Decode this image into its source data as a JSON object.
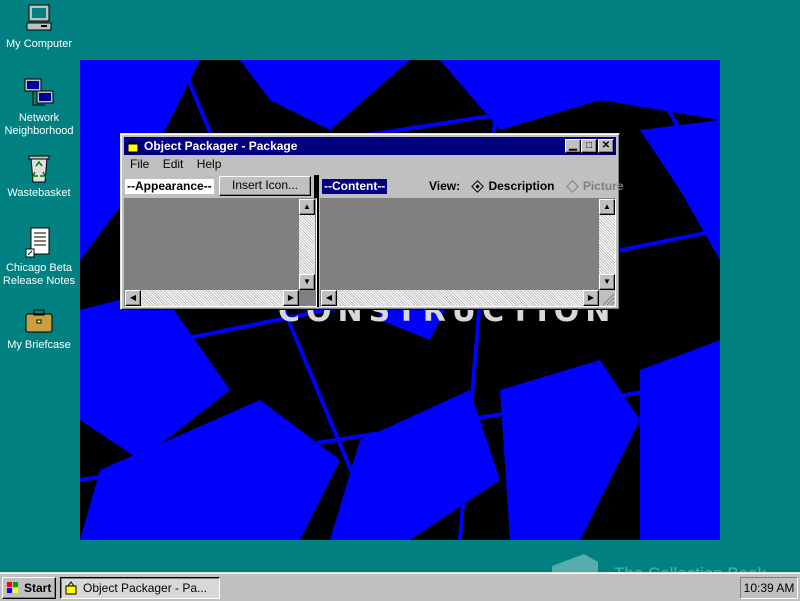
{
  "desktop": {
    "icons": [
      {
        "label": "My Computer",
        "icon": "computer-icon"
      },
      {
        "label": "Network Neighborhood",
        "icon": "network-icon"
      },
      {
        "label": "Wastebasket",
        "icon": "recycle-bin-icon"
      },
      {
        "label": "Chicago Beta Release Notes",
        "icon": "document-icon"
      },
      {
        "label": "My Briefcase",
        "icon": "briefcase-icon"
      }
    ],
    "wallpaper_text": "CONSTRUCTION",
    "background_color": "#008080",
    "wallpaper_accent": "#0000ff"
  },
  "window": {
    "title": "Object Packager - Package",
    "menu": [
      "File",
      "Edit",
      "Help"
    ],
    "appearance_label": "--Appearance--",
    "insert_icon_button": "Insert Icon...",
    "content_label": "--Content--",
    "view_label": "View:",
    "view_options": [
      {
        "label": "Description",
        "selected": true,
        "enabled": true
      },
      {
        "label": "Picture",
        "selected": false,
        "enabled": false
      }
    ],
    "title_color": "#000080"
  },
  "taskbar": {
    "start_label": "Start",
    "task_label": "Object Packager - Pa...",
    "clock": "10:39 AM"
  },
  "watermark": "The Collection Book"
}
